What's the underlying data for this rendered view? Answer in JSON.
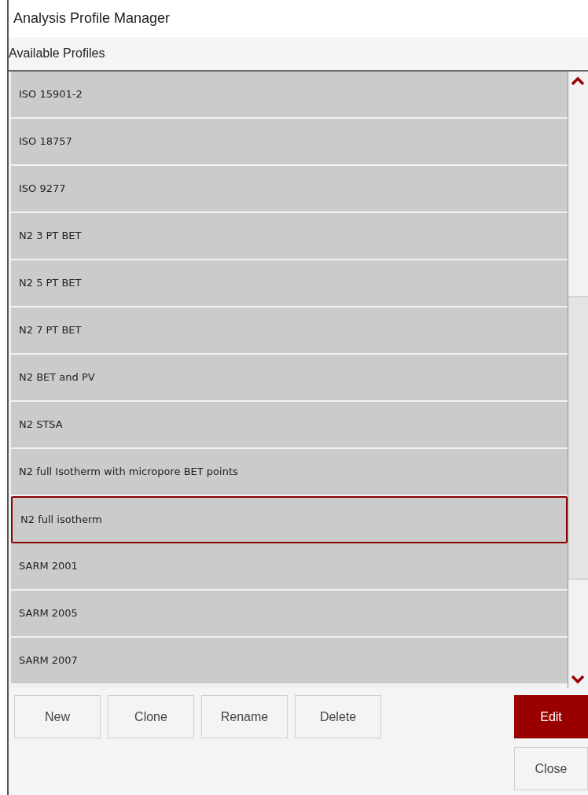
{
  "window": {
    "title": "Analysis Profile Manager"
  },
  "section_title": "Available Profiles",
  "profiles": [
    {
      "name": "ISO 15901-2",
      "selected": false
    },
    {
      "name": "ISO 18757",
      "selected": false
    },
    {
      "name": "ISO 9277",
      "selected": false
    },
    {
      "name": "N2 3 PT BET",
      "selected": false
    },
    {
      "name": "N2 5 PT BET",
      "selected": false
    },
    {
      "name": "N2 7 PT BET",
      "selected": false
    },
    {
      "name": "N2 BET and PV",
      "selected": false
    },
    {
      "name": "N2 STSA",
      "selected": false
    },
    {
      "name": "N2 full Isotherm with micropore BET points",
      "selected": false
    },
    {
      "name": "N2 full isotherm",
      "selected": true
    },
    {
      "name": "SARM 2001",
      "selected": false
    },
    {
      "name": "SARM 2005",
      "selected": false
    },
    {
      "name": "SARM 2007",
      "selected": false
    }
  ],
  "actions": [
    {
      "label": "New"
    },
    {
      "label": "Clone"
    },
    {
      "label": "Rename"
    },
    {
      "label": "Delete"
    }
  ],
  "edit_button": {
    "label": "Edit"
  },
  "close_button": {
    "label": "Close"
  }
}
